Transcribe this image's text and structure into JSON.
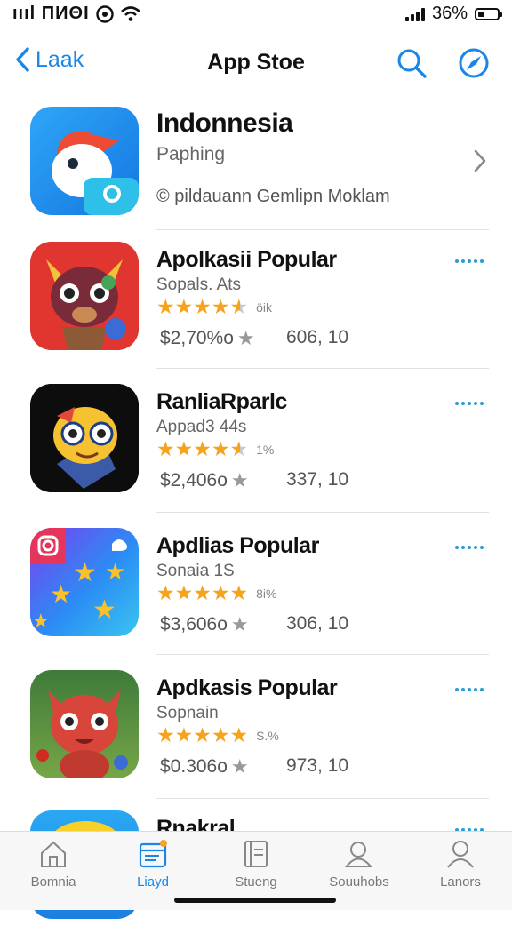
{
  "status_bar": {
    "left_text": "ıııl ПИΘI",
    "battery": "36%",
    "battery_level": 0.36
  },
  "nav": {
    "back_label": "Laak",
    "title": "App Stoe"
  },
  "featured": {
    "title": "Indonnesia",
    "subtitle": "Paphing",
    "meta": "© pildauann   Gemlipn Moklam"
  },
  "apps": [
    {
      "title": "Apolkasii Popular",
      "subtitle": "Sopals. Ats",
      "rating": 4.5,
      "rating_text": "öik",
      "price": "$2,70%o",
      "count": "606, 10"
    },
    {
      "title": "RanliaRparlc",
      "subtitle": "Appad3 44s",
      "rating": 4.5,
      "rating_text": "1%",
      "price": "$2,406o",
      "count": "337, 10"
    },
    {
      "title": "Apdlias Popular",
      "subtitle": "Sonaia 1S",
      "rating": 5,
      "rating_text": "8i%",
      "price": "$3,606o",
      "count": "306, 10"
    },
    {
      "title": "Apdkasis Popular",
      "subtitle": "Sopnain",
      "rating": 5,
      "rating_text": "S.%",
      "price": "$0.306o",
      "count": "973, 10"
    },
    {
      "title": "Rnakral"
    }
  ],
  "tabs": [
    {
      "label": "Bomnia",
      "icon": "home-icon"
    },
    {
      "label": "Liayd",
      "icon": "calendar-icon",
      "active": true
    },
    {
      "label": "Stueng",
      "icon": "book-icon"
    },
    {
      "label": "Souuhobs",
      "icon": "search-person-icon"
    },
    {
      "label": "Lanors",
      "icon": "person-icon"
    }
  ],
  "colors": {
    "accent": "#1a86e8",
    "star": "#f6a21a",
    "dots": "#2a9bd7"
  }
}
